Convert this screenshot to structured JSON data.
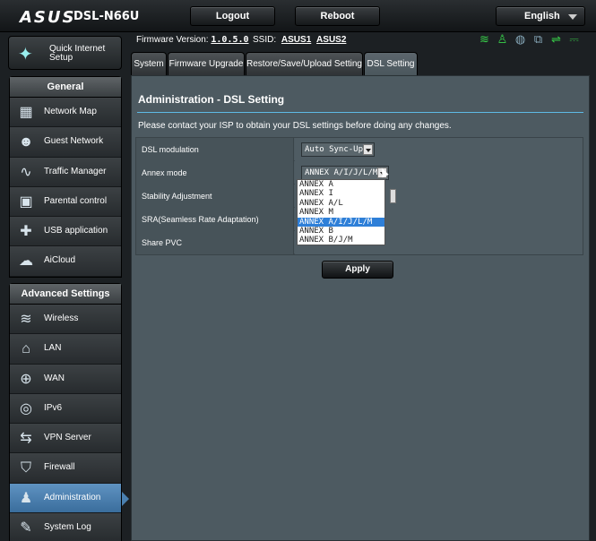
{
  "brand": {
    "logo": "ASUS",
    "model": "DSL-N66U"
  },
  "topbar": {
    "logout": "Logout",
    "reboot": "Reboot",
    "language": "English"
  },
  "quick_setup": {
    "label": "Quick Internet Setup"
  },
  "nav": {
    "general_title": "General",
    "general": [
      {
        "label": "Network Map",
        "icon": "network-map-icon"
      },
      {
        "label": "Guest Network",
        "icon": "guest-network-icon"
      },
      {
        "label": "Traffic Manager",
        "icon": "traffic-manager-icon"
      },
      {
        "label": "Parental control",
        "icon": "parental-control-icon"
      },
      {
        "label": "USB application",
        "icon": "usb-application-icon"
      },
      {
        "label": "AiCloud",
        "icon": "aicloud-icon"
      }
    ],
    "advanced_title": "Advanced Settings",
    "advanced": [
      {
        "label": "Wireless",
        "icon": "wireless-icon"
      },
      {
        "label": "LAN",
        "icon": "lan-icon"
      },
      {
        "label": "WAN",
        "icon": "wan-icon"
      },
      {
        "label": "IPv6",
        "icon": "ipv6-icon"
      },
      {
        "label": "VPN Server",
        "icon": "vpn-server-icon"
      },
      {
        "label": "Firewall",
        "icon": "firewall-icon"
      },
      {
        "label": "Administration",
        "icon": "administration-icon",
        "active": true
      },
      {
        "label": "System Log",
        "icon": "system-log-icon"
      }
    ]
  },
  "status": {
    "firmware_label": "Firmware Version:",
    "firmware_value": "1.0.5.0",
    "ssid_label": "SSID:",
    "ssid1": "ASUS1",
    "ssid2": "ASUS2"
  },
  "tabs": [
    {
      "label": "System"
    },
    {
      "label": "Firmware Upgrade"
    },
    {
      "label": "Restore/Save/Upload Setting"
    },
    {
      "label": "DSL Setting",
      "active": true
    }
  ],
  "page": {
    "title": "Administration - DSL Setting",
    "description": "Please contact your ISP to obtain your DSL settings before doing any changes.",
    "rows": [
      {
        "label": "DSL modulation",
        "value": "Auto Sync-Up"
      },
      {
        "label": "Annex mode",
        "value": "ANNEX A/I/J/L/M"
      },
      {
        "label": "Stability Adjustment"
      },
      {
        "label": "SRA(Seamless Rate Adaptation)"
      },
      {
        "label": "Share PVC"
      }
    ],
    "annex_options": [
      "ANNEX A",
      "ANNEX I",
      "ANNEX A/L",
      "ANNEX M",
      "ANNEX A/I/J/L/M",
      "ANNEX B",
      "ANNEX B/J/M"
    ],
    "annex_selected_index": 4,
    "apply": "Apply"
  },
  "colors": {
    "accent": "#5ebae6",
    "active_nav": "#4a80b0",
    "selected_option": "#2e7fd8"
  }
}
